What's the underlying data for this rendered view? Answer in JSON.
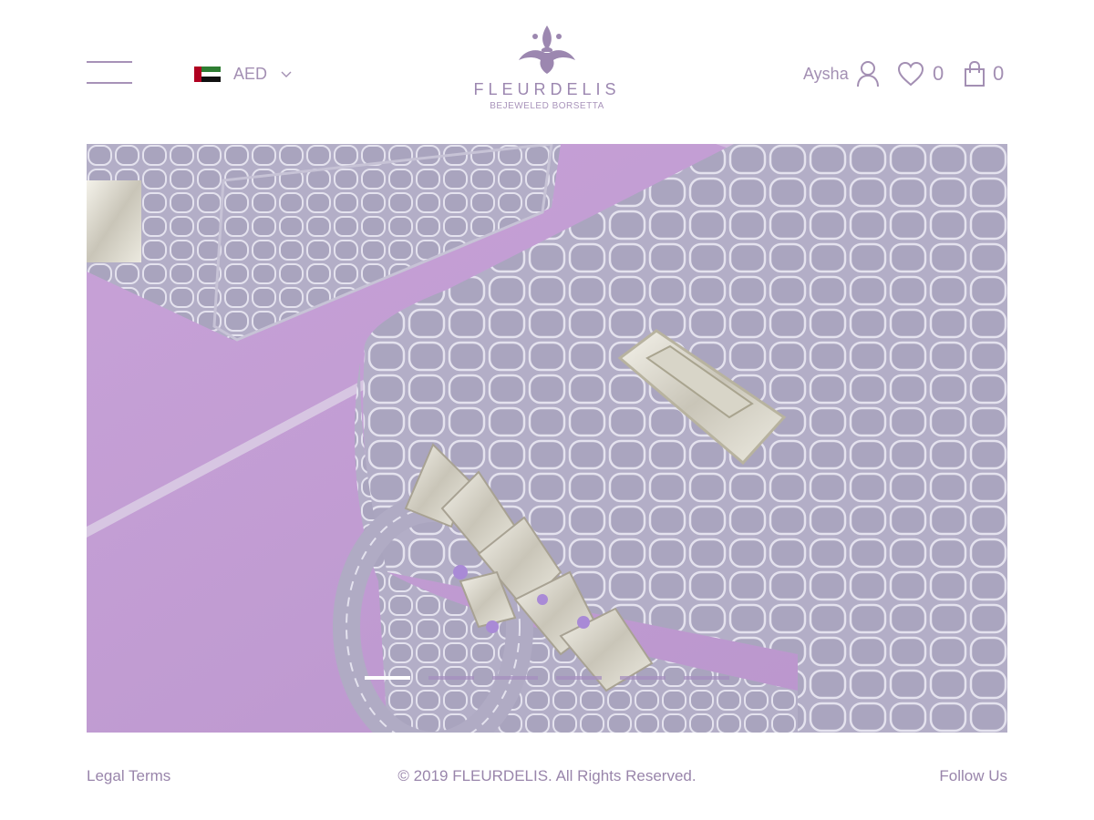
{
  "header": {
    "currency": {
      "code": "AED",
      "flag": "uae-flag-icon"
    },
    "logo": {
      "name": "FLEURDELIS",
      "tagline": "BEJEWELED BORSETTA"
    },
    "user": {
      "name": "Aysha"
    },
    "wishlist": {
      "count": "0"
    },
    "cart": {
      "count": "0"
    }
  },
  "hero": {
    "image": "lavender crocodile-embossed handbag with jeweled handle",
    "slides_total": 6,
    "active_slide": 1
  },
  "footer": {
    "legal_label": "Legal Terms",
    "copyright": "© 2019 FLEURDELIS. All Rights Reserved.",
    "follow_label": "Follow Us"
  },
  "colors": {
    "accent": "#a38fb3",
    "background": "#ffffff",
    "hero_bg": "#c79ed6"
  }
}
